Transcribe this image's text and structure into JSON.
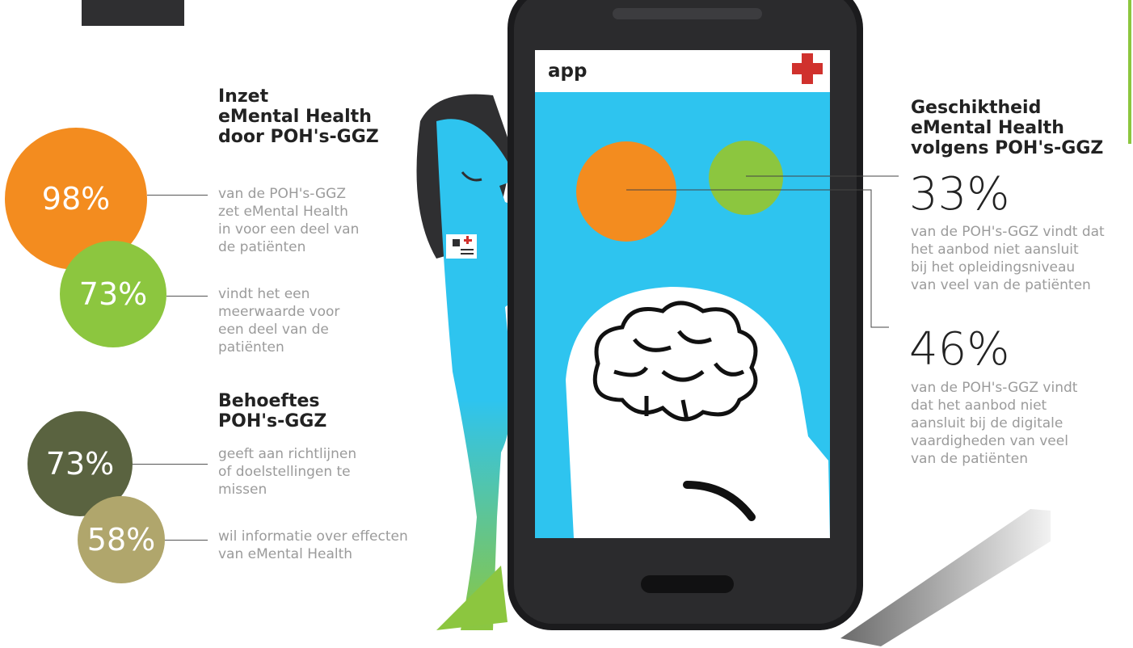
{
  "colors": {
    "orange": "#f38c1f",
    "green": "#8cc63f",
    "olive": "#5a6340",
    "khaki": "#b0a66c",
    "screen_blue": "#2ec4ef",
    "dark": "#2f2f31"
  },
  "phone": {
    "app_label": "app",
    "icons": [
      "red-cross-icon",
      "brain-icon",
      "person-head-icon"
    ]
  },
  "left": {
    "section1": {
      "title_lines": [
        "Inzet",
        "eMental Health",
        "door POH's-GGZ"
      ],
      "stat1": {
        "value": "98%",
        "desc_lines": [
          "van de POH's-GGZ",
          "zet eMental Health",
          "in voor een deel van",
          "de patiënten"
        ]
      },
      "stat2": {
        "value": "73%",
        "desc_lines": [
          "vindt het een",
          "meerwaarde voor",
          "een deel van de",
          "patiënten"
        ]
      }
    },
    "section2": {
      "title_lines": [
        "Behoeftes",
        "POH's-GGZ"
      ],
      "stat1": {
        "value": "73%",
        "desc_lines": [
          "geeft aan richtlijnen",
          "of doelstellingen te",
          "missen"
        ]
      },
      "stat2": {
        "value": "58%",
        "desc_lines": [
          "wil informatie over effecten",
          "van eMental Health"
        ]
      }
    }
  },
  "right": {
    "title_lines": [
      "Geschiktheid",
      "eMental Health",
      "volgens POH's-GGZ"
    ],
    "stat1": {
      "value": "33%",
      "desc_lines": [
        "van de POH's-GGZ vindt dat",
        "het aanbod niet aansluit",
        "bij het opleidingsniveau",
        "van veel van de patiënten"
      ]
    },
    "stat2": {
      "value": "46%",
      "desc_lines": [
        "van de POH's-GGZ vindt",
        "dat het aanbod niet",
        "aansluit bij de digitale",
        "vaardigheden van veel",
        "van de patiënten"
      ]
    }
  }
}
